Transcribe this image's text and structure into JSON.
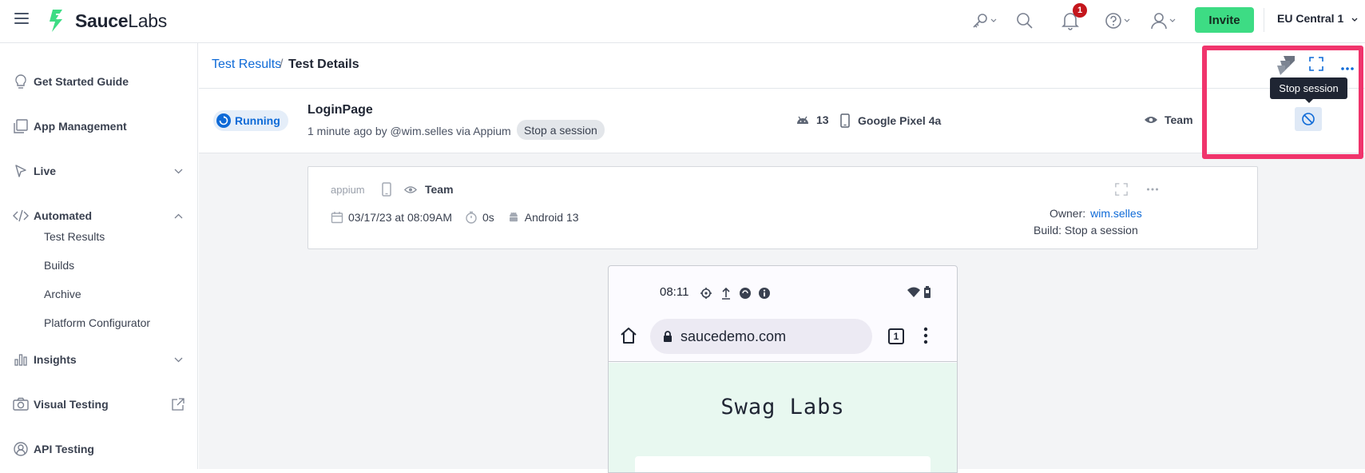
{
  "topbar": {
    "logo_bold": "Sauce",
    "logo_light": "Labs",
    "notification_count": "1",
    "invite_label": "Invite",
    "region_label": "EU Central 1",
    "brand_color": "#3ddc84"
  },
  "sidebar": {
    "items": [
      {
        "label": "Get Started Guide"
      },
      {
        "label": "App Management"
      },
      {
        "label": "Live"
      },
      {
        "label": "Automated"
      },
      {
        "label": "Insights"
      },
      {
        "label": "Visual Testing"
      },
      {
        "label": "API Testing"
      }
    ],
    "automated_sub": [
      {
        "label": "Test Results"
      },
      {
        "label": "Builds"
      },
      {
        "label": "Archive"
      },
      {
        "label": "Platform Configurator"
      }
    ]
  },
  "breadcrumb": {
    "parent": "Test Results",
    "separator": "/",
    "current": "Test Details"
  },
  "test": {
    "status": "Running",
    "name": "LoginPage",
    "meta": "1 minute ago by @wim.selles via Appium",
    "build_tag": "Stop a session",
    "os_version": "13",
    "device": "Google Pixel 4a",
    "visibility": "Team",
    "tooltip": "Stop session"
  },
  "card": {
    "framework": "appium",
    "visibility": "Team",
    "date": "03/17/23 at 08:09AM",
    "duration": "0s",
    "platform": "Android 13",
    "owner_label": "Owner:",
    "owner_value": "wim.selles",
    "build": "Build: Stop a session"
  },
  "phone": {
    "time": "08:11",
    "url": "saucedemo.com",
    "tab_count": "1",
    "page_title": "Swag Labs"
  },
  "colors": {
    "accent_blue": "#0e6ad7",
    "highlight": "#f0346c",
    "running_bg": "#e5eef9"
  }
}
